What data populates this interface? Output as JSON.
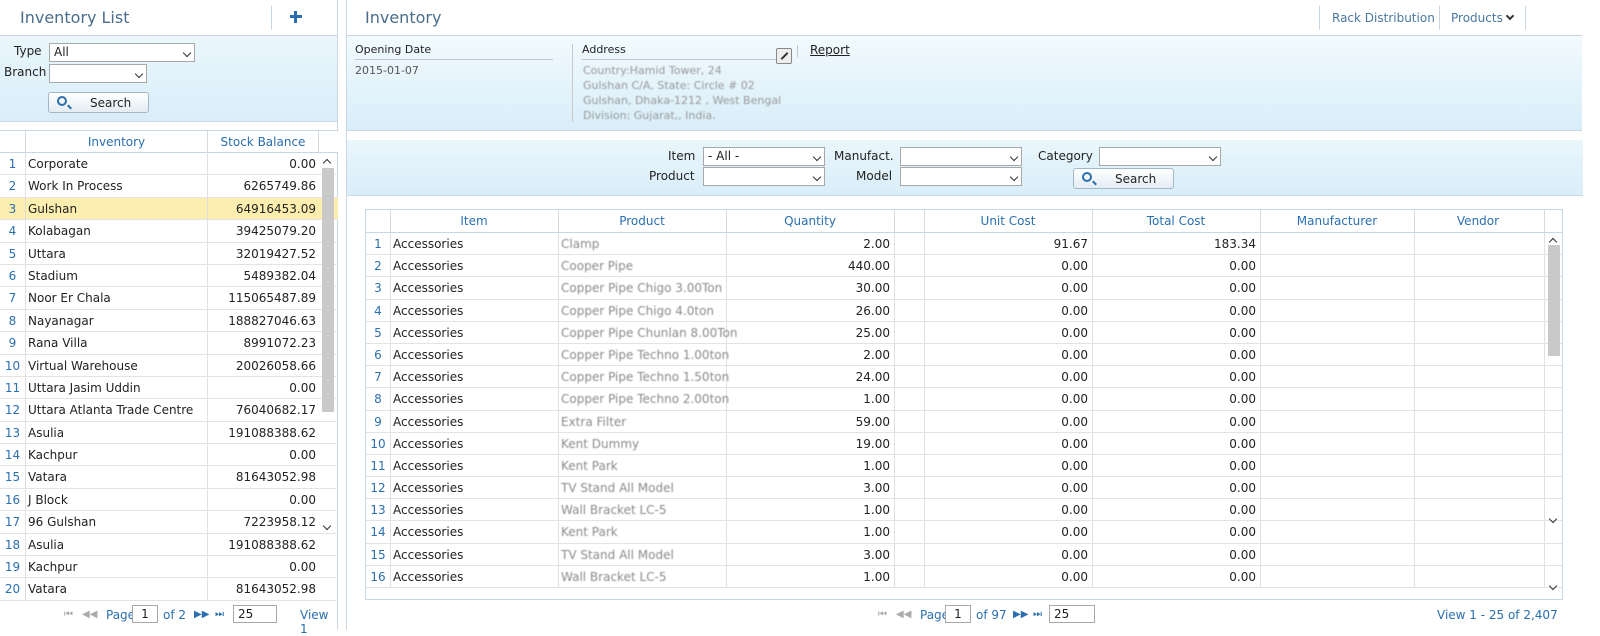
{
  "left": {
    "title": "Inventory List",
    "filter": {
      "type_label": "Type",
      "type_value": "All",
      "branch_label": "Branch",
      "branch_value": "",
      "search_label": "Search"
    },
    "columns": [
      "Inventory",
      "Stock Balance"
    ],
    "rows": [
      {
        "n": "1",
        "name": "Corporate",
        "val": "0.00"
      },
      {
        "n": "2",
        "name": "Work In Process",
        "val": "6265749.86"
      },
      {
        "n": "3",
        "name": "Gulshan",
        "val": "64916453.09"
      },
      {
        "n": "4",
        "name": "Kolabagan",
        "val": "39425079.20"
      },
      {
        "n": "5",
        "name": "Uttara",
        "val": "32019427.52"
      },
      {
        "n": "6",
        "name": "Stadium",
        "val": "5489382.04"
      },
      {
        "n": "7",
        "name": "Noor Er Chala",
        "val": "115065487.89"
      },
      {
        "n": "8",
        "name": "Nayanagar",
        "val": "188827046.63"
      },
      {
        "n": "9",
        "name": "Rana Villa",
        "val": "8991072.23"
      },
      {
        "n": "10",
        "name": "Virtual Warehouse",
        "val": "20026058.66"
      },
      {
        "n": "11",
        "name": "Uttara Jasim Uddin",
        "val": "0.00"
      },
      {
        "n": "12",
        "name": "Uttara Atlanta Trade Centre",
        "val": "76040682.17"
      },
      {
        "n": "13",
        "name": "Asulia",
        "val": "191088388.62"
      },
      {
        "n": "14",
        "name": "Kachpur",
        "val": "0.00"
      },
      {
        "n": "15",
        "name": "Vatara",
        "val": "81643052.98"
      },
      {
        "n": "16",
        "name": "J Block",
        "val": "0.00"
      },
      {
        "n": "17",
        "name": "96 Gulshan",
        "val": "7223958.12"
      },
      {
        "n": "18",
        "name": "Asulia",
        "val": "191088388.62"
      },
      {
        "n": "19",
        "name": "Kachpur",
        "val": "0.00"
      },
      {
        "n": "20",
        "name": "Vatara",
        "val": "81643052.98"
      }
    ],
    "pager": {
      "page_label": "Page",
      "page_value": "1",
      "of": "of 2",
      "size": "25",
      "view": "View 1"
    }
  },
  "right": {
    "title": "Inventory",
    "tabs": {
      "rack": "Rack Distribution",
      "products": "Products"
    },
    "info": {
      "opening_label": "Opening Date",
      "opening_value": "2015-01-07",
      "address_label": "Address",
      "address_lines": [
        "Country:Hamid Tower, 24",
        "Gulshan C/A, State: Circle # 02",
        "Gulshan, Dhaka-1212 , West Bengal",
        "Division: Gujarat,, India."
      ],
      "report": "Report"
    },
    "filter": {
      "item_label": "Item",
      "item_value": "- All -",
      "product_label": "Product",
      "manuf_label": "Manufact.",
      "model_label": "Model",
      "category_label": "Category",
      "search_label": "Search"
    },
    "columns": [
      "Item",
      "Product",
      "Quantity",
      "Unit Cost",
      "Total Cost",
      "Manufacturer",
      "Vendor"
    ],
    "rows": [
      {
        "n": "1",
        "item": "Accessories",
        "product": "Clamp",
        "qty": "2.00",
        "unit": "91.67",
        "total": "183.34"
      },
      {
        "n": "2",
        "item": "Accessories",
        "product": "Cooper Pipe",
        "qty": "440.00",
        "unit": "0.00",
        "total": "0.00"
      },
      {
        "n": "3",
        "item": "Accessories",
        "product": "Copper Pipe Chigo 3.00Ton",
        "qty": "30.00",
        "unit": "0.00",
        "total": "0.00"
      },
      {
        "n": "4",
        "item": "Accessories",
        "product": "Copper Pipe Chigo 4.0ton",
        "qty": "26.00",
        "unit": "0.00",
        "total": "0.00"
      },
      {
        "n": "5",
        "item": "Accessories",
        "product": "Copper Pipe Chunlan 8.00Ton",
        "qty": "25.00",
        "unit": "0.00",
        "total": "0.00"
      },
      {
        "n": "6",
        "item": "Accessories",
        "product": "Copper Pipe Techno 1.00ton",
        "qty": "2.00",
        "unit": "0.00",
        "total": "0.00"
      },
      {
        "n": "7",
        "item": "Accessories",
        "product": "Copper Pipe Techno 1.50ton",
        "qty": "24.00",
        "unit": "0.00",
        "total": "0.00"
      },
      {
        "n": "8",
        "item": "Accessories",
        "product": "Copper Pipe Techno 2.00ton",
        "qty": "1.00",
        "unit": "0.00",
        "total": "0.00"
      },
      {
        "n": "9",
        "item": "Accessories",
        "product": "Extra Filter",
        "qty": "59.00",
        "unit": "0.00",
        "total": "0.00"
      },
      {
        "n": "10",
        "item": "Accessories",
        "product": "Kent Dummy",
        "qty": "19.00",
        "unit": "0.00",
        "total": "0.00"
      },
      {
        "n": "11",
        "item": "Accessories",
        "product": "Kent Park",
        "qty": "1.00",
        "unit": "0.00",
        "total": "0.00"
      },
      {
        "n": "12",
        "item": "Accessories",
        "product": "TV Stand All Model",
        "qty": "3.00",
        "unit": "0.00",
        "total": "0.00"
      },
      {
        "n": "13",
        "item": "Accessories",
        "product": "Wall Bracket LC-5",
        "qty": "1.00",
        "unit": "0.00",
        "total": "0.00"
      },
      {
        "n": "14",
        "item": "Accessories",
        "product": "Kent Park",
        "qty": "1.00",
        "unit": "0.00",
        "total": "0.00"
      },
      {
        "n": "15",
        "item": "Accessories",
        "product": "TV Stand All Model",
        "qty": "3.00",
        "unit": "0.00",
        "total": "0.00"
      },
      {
        "n": "16",
        "item": "Accessories",
        "product": "Wall Bracket LC-5",
        "qty": "1.00",
        "unit": "0.00",
        "total": "0.00"
      }
    ],
    "pager": {
      "page_label": "Page",
      "page_value": "1",
      "of": "of 97",
      "size": "25",
      "view": "View 1 - 25 of 2,407"
    }
  },
  "colors": {
    "accent": "#2a6fb0",
    "title": "#4a6d8c",
    "selected_row": "#fbeeae",
    "panel_bg": "#d9eef9"
  }
}
